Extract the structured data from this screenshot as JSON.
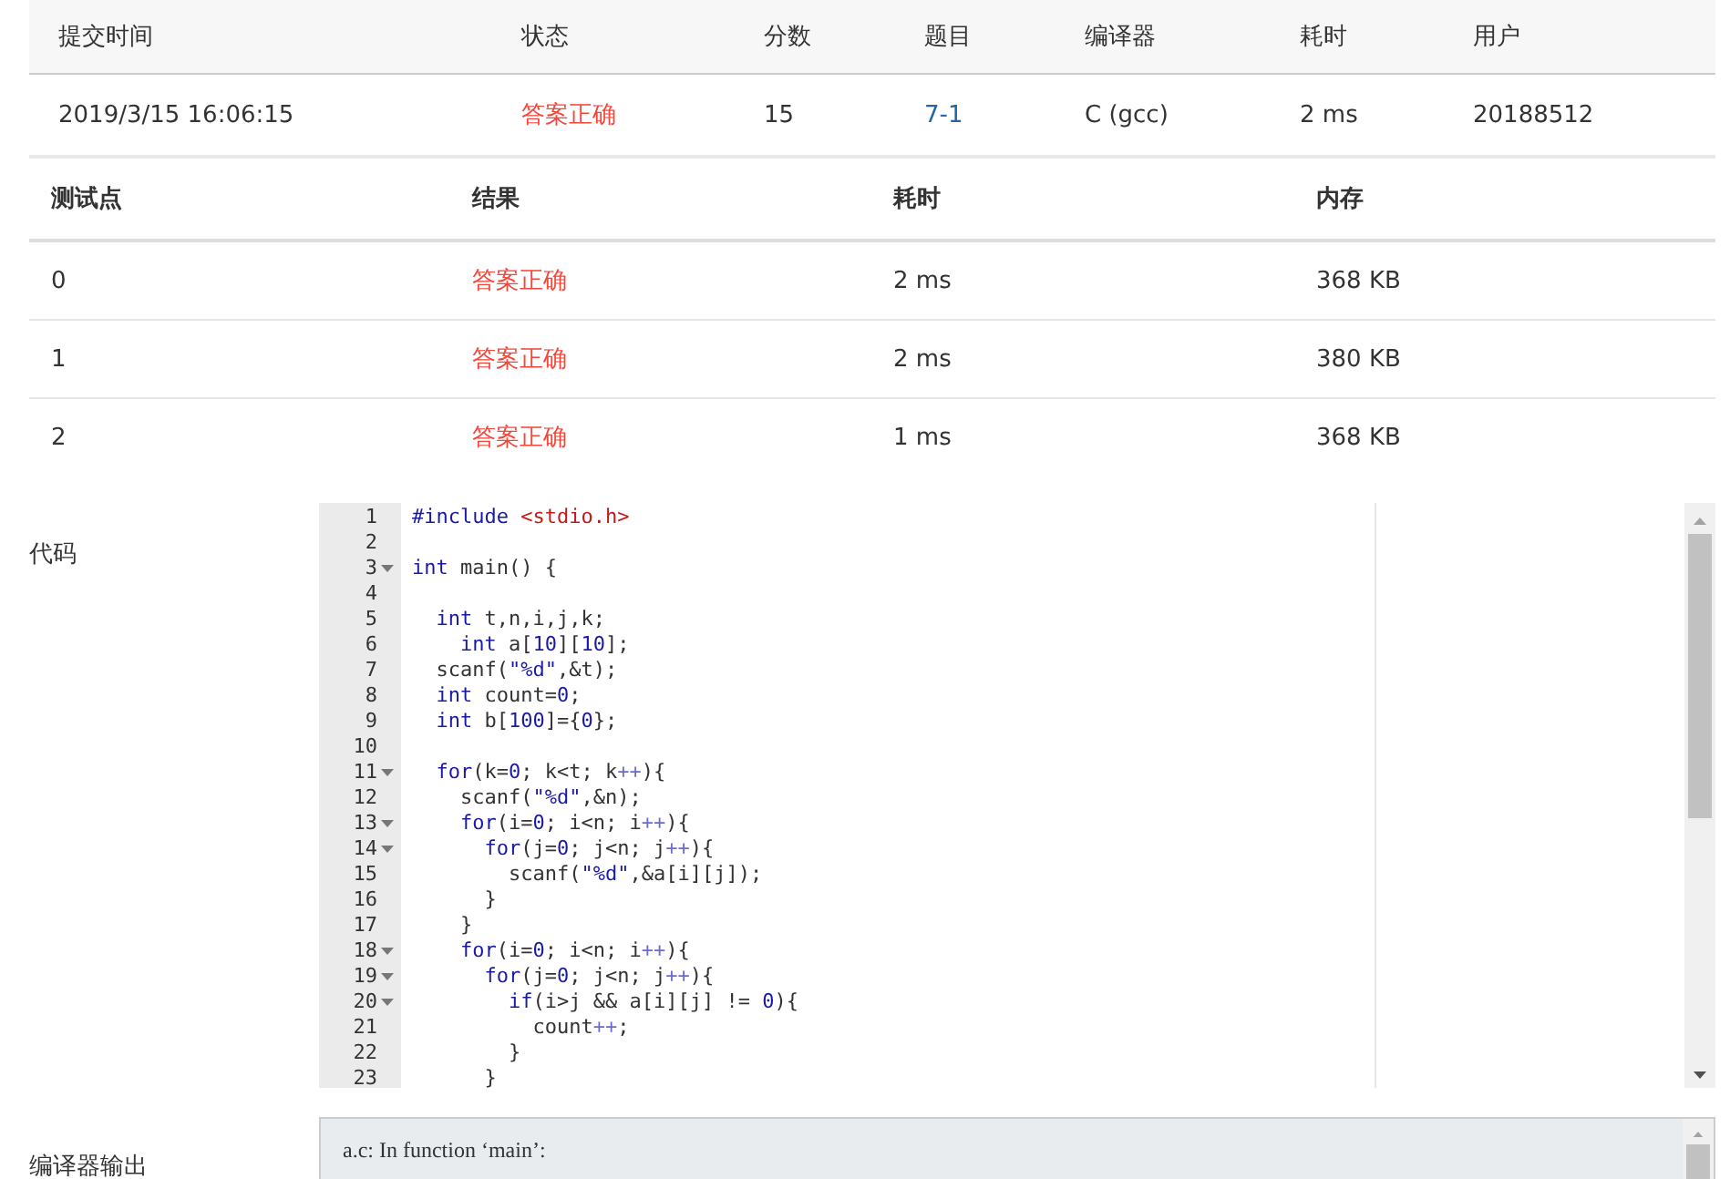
{
  "submission": {
    "columns": [
      "提交时间",
      "状态",
      "分数",
      "题目",
      "编译器",
      "耗时",
      "用户"
    ],
    "row": [
      {
        "text": "2019/3/15 16:06:15",
        "kind": "plain"
      },
      {
        "text": "答案正确",
        "kind": "status"
      },
      {
        "text": "15",
        "kind": "plain"
      },
      {
        "text": "7-1",
        "kind": "link"
      },
      {
        "text": "C (gcc)",
        "kind": "plain"
      },
      {
        "text": "2 ms",
        "kind": "plain"
      },
      {
        "text": "20188512",
        "kind": "plain"
      }
    ]
  },
  "testcases": {
    "columns": [
      "测试点",
      "结果",
      "耗时",
      "内存"
    ],
    "rows": [
      {
        "cells": [
          "0",
          "答案正确",
          "2 ms",
          "368 KB"
        ]
      },
      {
        "cells": [
          "1",
          "答案正确",
          "2 ms",
          "380 KB"
        ]
      },
      {
        "cells": [
          "2",
          "答案正确",
          "1 ms",
          "368 KB"
        ]
      }
    ]
  },
  "code": {
    "label": "代码",
    "lines": [
      {
        "number": "1",
        "fold": false,
        "tokens": [
          {
            "kind": "meta",
            "text": "#include "
          },
          {
            "kind": "header",
            "text": "<stdio.h>"
          }
        ]
      },
      {
        "number": "2",
        "fold": false
      },
      {
        "number": "3",
        "fold": true,
        "tokens": [
          {
            "kind": "keyword",
            "text": "int"
          },
          {
            "kind": "plain",
            "text": " main() {"
          }
        ]
      },
      {
        "number": "4",
        "fold": false
      },
      {
        "number": "5",
        "fold": false,
        "tokens": [
          {
            "kind": "keyword",
            "text": "  int"
          },
          {
            "kind": "plain",
            "text": " t,n,i,j,k;"
          }
        ]
      },
      {
        "number": "6",
        "fold": false,
        "tokens": [
          {
            "kind": "keyword",
            "text": "    int"
          },
          {
            "kind": "plain",
            "text": " a["
          },
          {
            "kind": "number",
            "text": "10"
          },
          {
            "kind": "plain",
            "text": "]["
          },
          {
            "kind": "number",
            "text": "10"
          },
          {
            "kind": "plain",
            "text": "];"
          }
        ]
      },
      {
        "number": "7",
        "fold": false,
        "tokens": [
          {
            "kind": "plain",
            "text": "  scanf("
          },
          {
            "kind": "string",
            "text": "\"%d\""
          },
          {
            "kind": "plain",
            "text": ",&t);"
          }
        ]
      },
      {
        "number": "8",
        "fold": false,
        "tokens": [
          {
            "kind": "keyword",
            "text": "  int"
          },
          {
            "kind": "plain",
            "text": " count="
          },
          {
            "kind": "number",
            "text": "0"
          },
          {
            "kind": "plain",
            "text": ";"
          }
        ]
      },
      {
        "number": "9",
        "fold": false,
        "tokens": [
          {
            "kind": "keyword",
            "text": "  int"
          },
          {
            "kind": "plain",
            "text": " b["
          },
          {
            "kind": "number",
            "text": "100"
          },
          {
            "kind": "plain",
            "text": "]={"
          },
          {
            "kind": "number",
            "text": "0"
          },
          {
            "kind": "plain",
            "text": "};"
          }
        ]
      },
      {
        "number": "10",
        "fold": false
      },
      {
        "number": "11",
        "fold": true,
        "tokens": [
          {
            "kind": "keyword",
            "text": "  for"
          },
          {
            "kind": "plain",
            "text": "(k="
          },
          {
            "kind": "number",
            "text": "0"
          },
          {
            "kind": "plain",
            "text": "; k<t; k"
          },
          {
            "kind": "operator",
            "text": "++"
          },
          {
            "kind": "plain",
            "text": "){"
          }
        ]
      },
      {
        "number": "12",
        "fold": false,
        "tokens": [
          {
            "kind": "plain",
            "text": "    scanf("
          },
          {
            "kind": "string",
            "text": "\"%d\""
          },
          {
            "kind": "plain",
            "text": ",&n);"
          }
        ]
      },
      {
        "number": "13",
        "fold": true,
        "tokens": [
          {
            "kind": "keyword",
            "text": "    for"
          },
          {
            "kind": "plain",
            "text": "(i="
          },
          {
            "kind": "number",
            "text": "0"
          },
          {
            "kind": "plain",
            "text": "; i<n; i"
          },
          {
            "kind": "operator",
            "text": "++"
          },
          {
            "kind": "plain",
            "text": "){"
          }
        ]
      },
      {
        "number": "14",
        "fold": true,
        "tokens": [
          {
            "kind": "keyword",
            "text": "      for"
          },
          {
            "kind": "plain",
            "text": "(j="
          },
          {
            "kind": "number",
            "text": "0"
          },
          {
            "kind": "plain",
            "text": "; j<n; j"
          },
          {
            "kind": "operator",
            "text": "++"
          },
          {
            "kind": "plain",
            "text": "){"
          }
        ]
      },
      {
        "number": "15",
        "fold": false,
        "tokens": [
          {
            "kind": "plain",
            "text": "        scanf("
          },
          {
            "kind": "string",
            "text": "\"%d\""
          },
          {
            "kind": "plain",
            "text": ",&a[i][j]);"
          }
        ]
      },
      {
        "number": "16",
        "fold": false,
        "tokens": [
          {
            "kind": "plain",
            "text": "      }"
          }
        ]
      },
      {
        "number": "17",
        "fold": false,
        "tokens": [
          {
            "kind": "plain",
            "text": "    }"
          }
        ]
      },
      {
        "number": "18",
        "fold": true,
        "tokens": [
          {
            "kind": "keyword",
            "text": "    for"
          },
          {
            "kind": "plain",
            "text": "(i="
          },
          {
            "kind": "number",
            "text": "0"
          },
          {
            "kind": "plain",
            "text": "; i<n; i"
          },
          {
            "kind": "operator",
            "text": "++"
          },
          {
            "kind": "plain",
            "text": "){"
          }
        ]
      },
      {
        "number": "19",
        "fold": true,
        "tokens": [
          {
            "kind": "keyword",
            "text": "      for"
          },
          {
            "kind": "plain",
            "text": "(j="
          },
          {
            "kind": "number",
            "text": "0"
          },
          {
            "kind": "plain",
            "text": "; j<n; j"
          },
          {
            "kind": "operator",
            "text": "++"
          },
          {
            "kind": "plain",
            "text": "){"
          }
        ]
      },
      {
        "number": "20",
        "fold": true,
        "tokens": [
          {
            "kind": "keyword",
            "text": "        if"
          },
          {
            "kind": "plain",
            "text": "(i>j && a[i][j] != "
          },
          {
            "kind": "number",
            "text": "0"
          },
          {
            "kind": "plain",
            "text": "){"
          }
        ]
      },
      {
        "number": "21",
        "fold": false,
        "tokens": [
          {
            "kind": "plain",
            "text": "          count"
          },
          {
            "kind": "operator",
            "text": "++"
          },
          {
            "kind": "plain",
            "text": ";"
          }
        ]
      },
      {
        "number": "22",
        "fold": false,
        "tokens": [
          {
            "kind": "plain",
            "text": "        }"
          }
        ]
      },
      {
        "number": "23",
        "fold": false,
        "tokens": [
          {
            "kind": "plain",
            "text": "      }"
          }
        ]
      }
    ]
  },
  "compiler_output": {
    "label": "编译器输出",
    "lines": [
      "a.c: In function ‘main’:"
    ]
  }
}
